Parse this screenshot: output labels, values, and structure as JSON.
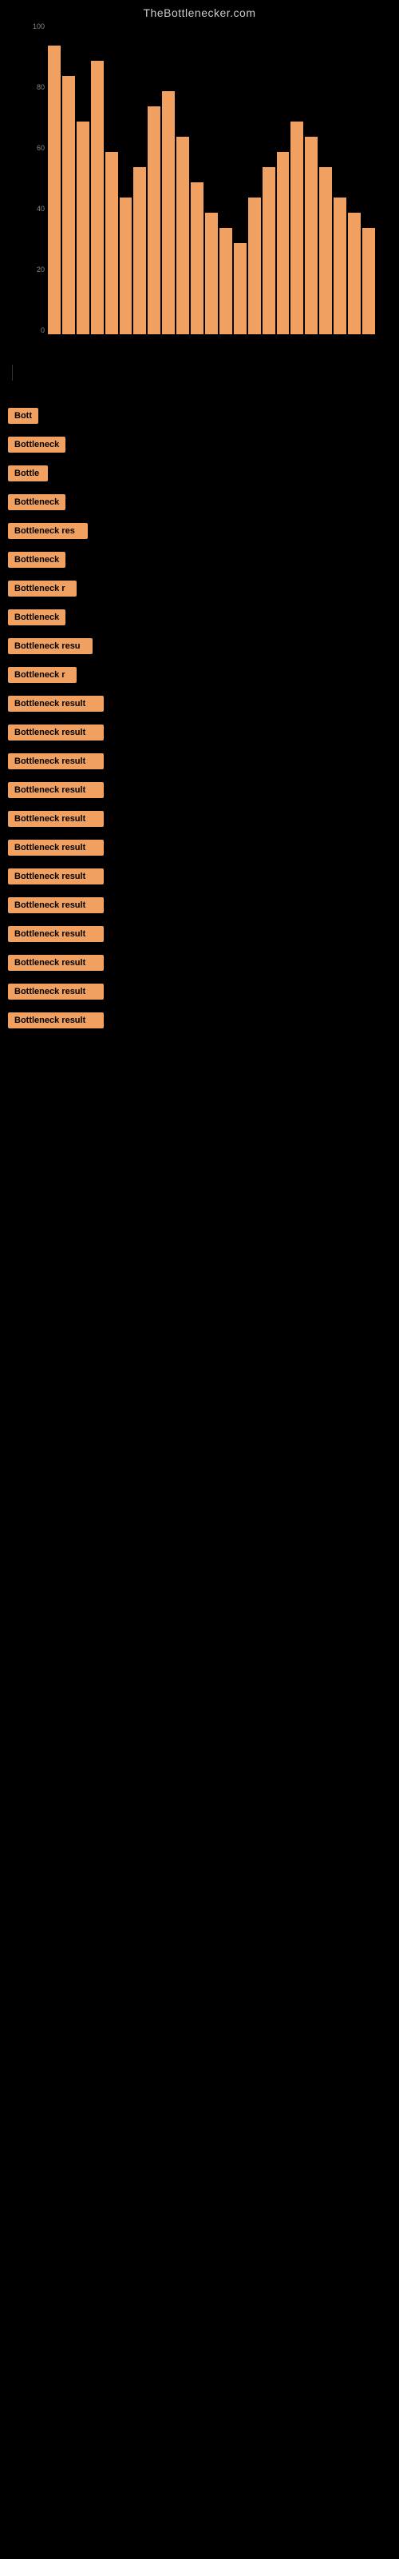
{
  "site": {
    "title": "TheBottlenecker.com"
  },
  "chart": {
    "y_axis_labels": [
      "100",
      "80",
      "60",
      "40",
      "20",
      "0"
    ],
    "bars": [
      {
        "height": 95
      },
      {
        "height": 85
      },
      {
        "height": 70
      },
      {
        "height": 90
      },
      {
        "height": 60
      },
      {
        "height": 45
      },
      {
        "height": 55
      },
      {
        "height": 75
      },
      {
        "height": 80
      },
      {
        "height": 65
      },
      {
        "height": 50
      },
      {
        "height": 40
      },
      {
        "height": 35
      },
      {
        "height": 30
      },
      {
        "height": 45
      },
      {
        "height": 55
      },
      {
        "height": 60
      },
      {
        "height": 70
      },
      {
        "height": 65
      },
      {
        "height": 55
      },
      {
        "height": 45
      },
      {
        "height": 40
      },
      {
        "height": 35
      }
    ]
  },
  "results": {
    "label": "Bottleneck result",
    "items": [
      {
        "label": "Bott",
        "width": 38
      },
      {
        "label": "Bottleneck",
        "width": 72
      },
      {
        "label": "Bottle",
        "width": 50
      },
      {
        "label": "Bottleneck",
        "width": 72
      },
      {
        "label": "Bottleneck res",
        "width": 100
      },
      {
        "label": "Bottleneck",
        "width": 72
      },
      {
        "label": "Bottleneck r",
        "width": 86
      },
      {
        "label": "Bottleneck",
        "width": 72
      },
      {
        "label": "Bottleneck resu",
        "width": 106
      },
      {
        "label": "Bottleneck r",
        "width": 86
      },
      {
        "label": "Bottleneck result",
        "width": 120
      },
      {
        "label": "Bottleneck result",
        "width": 120
      },
      {
        "label": "Bottleneck result",
        "width": 120
      },
      {
        "label": "Bottleneck result",
        "width": 120
      },
      {
        "label": "Bottleneck result",
        "width": 120
      },
      {
        "label": "Bottleneck result",
        "width": 120
      },
      {
        "label": "Bottleneck result",
        "width": 120
      },
      {
        "label": "Bottleneck result",
        "width": 120
      },
      {
        "label": "Bottleneck result",
        "width": 120
      },
      {
        "label": "Bottleneck result",
        "width": 120
      },
      {
        "label": "Bottleneck result",
        "width": 120
      },
      {
        "label": "Bottleneck result",
        "width": 120
      }
    ]
  }
}
